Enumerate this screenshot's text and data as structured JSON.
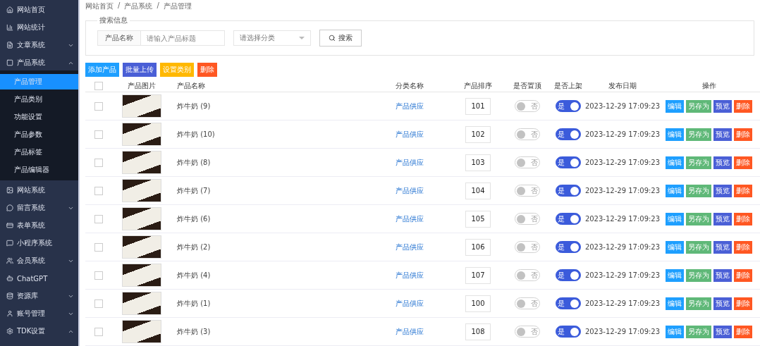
{
  "sidebar": {
    "items": [
      {
        "label": "网站首页",
        "selected": false
      },
      {
        "label": "网站统计",
        "selected": false
      },
      {
        "label": "文章系统",
        "selected": false,
        "expanded": false
      },
      {
        "label": "产品系统",
        "selected": false,
        "expanded": true,
        "children": [
          {
            "label": "产品管理",
            "selected": true
          },
          {
            "label": "产品类别",
            "selected": false
          },
          {
            "label": "功能设置",
            "selected": false
          },
          {
            "label": "产品参数",
            "selected": false
          },
          {
            "label": "产品标签",
            "selected": false
          },
          {
            "label": "产品编辑器",
            "selected": false
          }
        ]
      },
      {
        "label": "网站系统",
        "selected": false
      },
      {
        "label": "留言系统",
        "selected": false,
        "expanded": false
      },
      {
        "label": "表单系统",
        "selected": false
      },
      {
        "label": "小程序系统",
        "selected": false
      },
      {
        "label": "会员系统",
        "selected": false,
        "expanded": false
      },
      {
        "label": "ChatGPT",
        "selected": false
      },
      {
        "label": "资源库",
        "selected": false,
        "expanded": false
      },
      {
        "label": "账号管理",
        "selected": false,
        "expanded": false
      },
      {
        "label": "TDK设置",
        "selected": false,
        "expanded": true
      }
    ]
  },
  "breadcrumb": [
    {
      "label": "网站首页"
    },
    {
      "separator": "/",
      "label": "产品系统"
    },
    {
      "separator": "/",
      "label": "产品管理"
    }
  ],
  "search": {
    "legend": "搜索信息",
    "field_label": "产品名称",
    "placeholder": "请输入产品标题",
    "category_placeholder": "请选择分类",
    "button": "搜索"
  },
  "actions": [
    {
      "label": "添加产品",
      "color": "#1e9fff"
    },
    {
      "label": "批量上传",
      "color": "#4a5fd6"
    },
    {
      "label": "设置类别",
      "color": "#ffb800"
    },
    {
      "label": "删除",
      "color": "#ff5722"
    }
  ],
  "table": {
    "select_all_checked": false,
    "columns": [
      "产品图片",
      "产品名称",
      "分类名称",
      "产品排序",
      "是否置顶",
      "是否上架",
      "发布日期",
      "操作"
    ],
    "rows": [
      {
        "checked": false,
        "name": "炸牛奶 (9)",
        "category": "产品供应",
        "sort": "101",
        "top": {
          "on": false,
          "label": "否"
        },
        "shelf": {
          "on": true,
          "label": "是"
        },
        "date": "2023-12-29 17:09:23",
        "actions": [
          {
            "label": "编辑",
            "color": "#1e9fff"
          },
          {
            "label": "另存为",
            "color": "#5fb878"
          },
          {
            "label": "预览",
            "color": "#4a5fd6"
          },
          {
            "label": "删除",
            "color": "#ff5722"
          }
        ]
      },
      {
        "checked": false,
        "name": "炸牛奶 (10)",
        "category": "产品供应",
        "sort": "102",
        "top": {
          "on": false,
          "label": "否"
        },
        "shelf": {
          "on": true,
          "label": "是"
        },
        "date": "2023-12-29 17:09:23",
        "actions": [
          {
            "label": "编辑",
            "color": "#1e9fff"
          },
          {
            "label": "另存为",
            "color": "#5fb878"
          },
          {
            "label": "预览",
            "color": "#4a5fd6"
          },
          {
            "label": "删除",
            "color": "#ff5722"
          }
        ]
      },
      {
        "checked": false,
        "name": "炸牛奶 (8)",
        "category": "产品供应",
        "sort": "103",
        "top": {
          "on": false,
          "label": "否"
        },
        "shelf": {
          "on": true,
          "label": "是"
        },
        "date": "2023-12-29 17:09:23",
        "actions": [
          {
            "label": "编辑",
            "color": "#1e9fff"
          },
          {
            "label": "另存为",
            "color": "#5fb878"
          },
          {
            "label": "预览",
            "color": "#4a5fd6"
          },
          {
            "label": "删除",
            "color": "#ff5722"
          }
        ]
      },
      {
        "checked": false,
        "name": "炸牛奶 (7)",
        "category": "产品供应",
        "sort": "104",
        "top": {
          "on": false,
          "label": "否"
        },
        "shelf": {
          "on": true,
          "label": "是"
        },
        "date": "2023-12-29 17:09:23",
        "actions": [
          {
            "label": "编辑",
            "color": "#1e9fff"
          },
          {
            "label": "另存为",
            "color": "#5fb878"
          },
          {
            "label": "预览",
            "color": "#4a5fd6"
          },
          {
            "label": "删除",
            "color": "#ff5722"
          }
        ]
      },
      {
        "checked": false,
        "name": "炸牛奶 (6)",
        "category": "产品供应",
        "sort": "105",
        "top": {
          "on": false,
          "label": "否"
        },
        "shelf": {
          "on": true,
          "label": "是"
        },
        "date": "2023-12-29 17:09:23",
        "actions": [
          {
            "label": "编辑",
            "color": "#1e9fff"
          },
          {
            "label": "另存为",
            "color": "#5fb878"
          },
          {
            "label": "预览",
            "color": "#4a5fd6"
          },
          {
            "label": "删除",
            "color": "#ff5722"
          }
        ]
      },
      {
        "checked": false,
        "name": "炸牛奶 (2)",
        "category": "产品供应",
        "sort": "106",
        "top": {
          "on": false,
          "label": "否"
        },
        "shelf": {
          "on": true,
          "label": "是"
        },
        "date": "2023-12-29 17:09:23",
        "actions": [
          {
            "label": "编辑",
            "color": "#1e9fff"
          },
          {
            "label": "另存为",
            "color": "#5fb878"
          },
          {
            "label": "预览",
            "color": "#4a5fd6"
          },
          {
            "label": "删除",
            "color": "#ff5722"
          }
        ]
      },
      {
        "checked": false,
        "name": "炸牛奶 (4)",
        "category": "产品供应",
        "sort": "107",
        "top": {
          "on": false,
          "label": "否"
        },
        "shelf": {
          "on": true,
          "label": "是"
        },
        "date": "2023-12-29 17:09:23",
        "actions": [
          {
            "label": "编辑",
            "color": "#1e9fff"
          },
          {
            "label": "另存为",
            "color": "#5fb878"
          },
          {
            "label": "预览",
            "color": "#4a5fd6"
          },
          {
            "label": "删除",
            "color": "#ff5722"
          }
        ]
      },
      {
        "checked": false,
        "name": "炸牛奶 (1)",
        "category": "产品供应",
        "sort": "100",
        "top": {
          "on": false,
          "label": "否"
        },
        "shelf": {
          "on": true,
          "label": "是"
        },
        "date": "2023-12-29 17:09:23",
        "actions": [
          {
            "label": "编辑",
            "color": "#1e9fff"
          },
          {
            "label": "另存为",
            "color": "#5fb878"
          },
          {
            "label": "预览",
            "color": "#4a5fd6"
          },
          {
            "label": "删除",
            "color": "#ff5722"
          }
        ]
      },
      {
        "checked": false,
        "name": "炸牛奶 (3)",
        "category": "产品供应",
        "sort": "108",
        "top": {
          "on": false,
          "label": "否"
        },
        "shelf": {
          "on": true,
          "label": "是"
        },
        "date": "2023-12-29 17:09:23",
        "actions": [
          {
            "label": "编辑",
            "color": "#1e9fff"
          },
          {
            "label": "另存为",
            "color": "#5fb878"
          },
          {
            "label": "预览",
            "color": "#4a5fd6"
          },
          {
            "label": "删除",
            "color": "#ff5722"
          }
        ]
      }
    ]
  }
}
